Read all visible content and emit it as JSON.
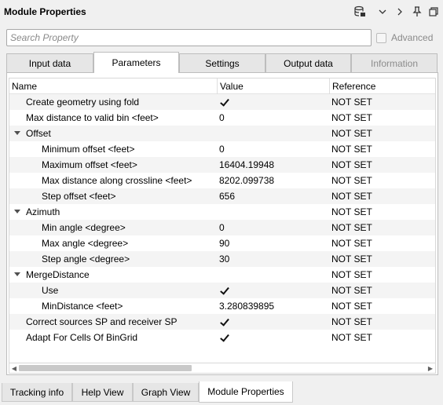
{
  "window": {
    "title": "Module Properties",
    "toolbar_icons": [
      "database-icon",
      "chevron-down-icon",
      "chevron-right-icon",
      "pin-icon",
      "restore-icon"
    ]
  },
  "search": {
    "placeholder": "Search Property",
    "value": ""
  },
  "advanced": {
    "label": "Advanced",
    "checked": false
  },
  "tabs": [
    {
      "label": "Input data",
      "active": false,
      "enabled": true
    },
    {
      "label": "Parameters",
      "active": true,
      "enabled": true
    },
    {
      "label": "Settings",
      "active": false,
      "enabled": true
    },
    {
      "label": "Output data",
      "active": false,
      "enabled": true
    },
    {
      "label": "Information",
      "active": false,
      "enabled": false
    }
  ],
  "table": {
    "columns": [
      "Name",
      "Value",
      "Reference"
    ],
    "rows": [
      {
        "name": "Create geometry using fold",
        "value": "",
        "checkbox": true,
        "reference": "NOT SET"
      },
      {
        "name": "Max distance to valid bin <feet>",
        "value": "0",
        "reference": "NOT SET"
      },
      {
        "name": "Offset",
        "value": "",
        "group": true,
        "reference": "NOT SET"
      },
      {
        "name": "Minimum offset <feet>",
        "value": "0",
        "reference": "NOT SET"
      },
      {
        "name": "Maximum offset <feet>",
        "value": "16404.19948",
        "reference": "NOT SET"
      },
      {
        "name": "Max distance along crossline <feet>",
        "value": "8202.099738",
        "reference": "NOT SET"
      },
      {
        "name": "Step offset <feet>",
        "value": "656",
        "reference": "NOT SET"
      },
      {
        "name": "Azimuth",
        "value": "",
        "group": true,
        "reference": "NOT SET"
      },
      {
        "name": "Min angle <degree>",
        "value": "0",
        "reference": "NOT SET"
      },
      {
        "name": "Max angle <degree>",
        "value": "90",
        "reference": "NOT SET"
      },
      {
        "name": "Step angle <degree>",
        "value": "30",
        "reference": "NOT SET"
      },
      {
        "name": "MergeDistance",
        "value": "",
        "group": true,
        "reference": "NOT SET"
      },
      {
        "name": "Use",
        "value": "",
        "checkbox": true,
        "reference": "NOT SET"
      },
      {
        "name": "MinDistance <feet>",
        "value": "3.280839895",
        "reference": "NOT SET"
      },
      {
        "name": "Correct sources SP and receiver SP",
        "value": "",
        "checkbox": true,
        "reference": "NOT SET"
      },
      {
        "name": "Adapt For Cells Of BinGrid",
        "value": "",
        "checkbox": true,
        "reference": "NOT SET"
      }
    ]
  },
  "bottom_tabs": [
    {
      "label": "Tracking info",
      "active": false
    },
    {
      "label": "Help View",
      "active": false
    },
    {
      "label": "Graph View",
      "active": false
    },
    {
      "label": "Module Properties",
      "active": true
    }
  ]
}
